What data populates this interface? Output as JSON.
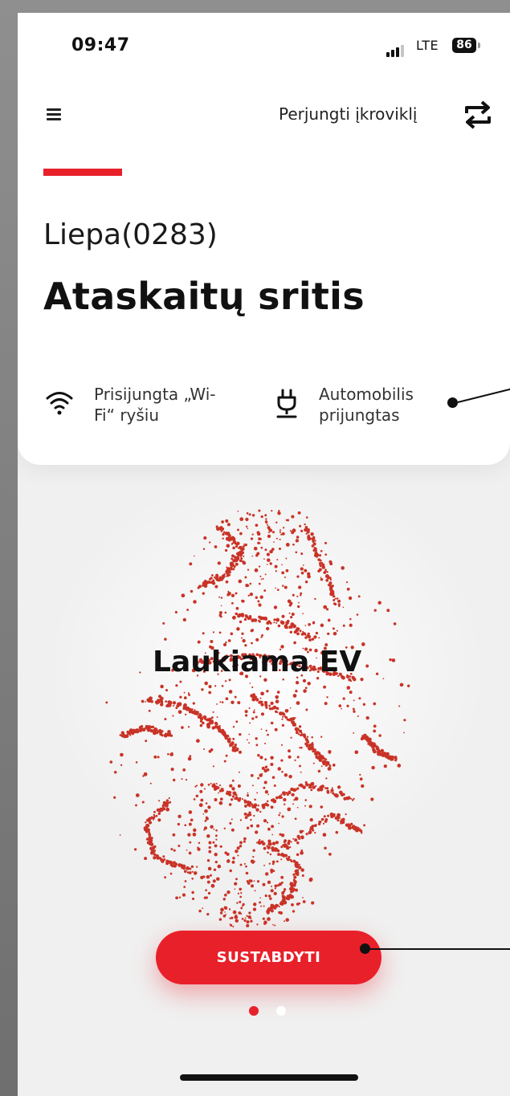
{
  "status_bar": {
    "time": "09:47",
    "network": "LTE",
    "battery": "86"
  },
  "header": {
    "menu_icon": "hamburger-menu-icon",
    "switch_label": "Perjungti įkroviklį",
    "switch_icon": "swap-arrows-icon"
  },
  "charger": {
    "name": "Liepa(0283)",
    "section_title": "Ataskaitų sritis",
    "wifi_status": "Prisijungta „Wi-Fi“ ryšiu",
    "wifi_status_line1": "Prisijungta „Wi-",
    "wifi_status_line2": "Fi“ ryšiu",
    "car_status": "Automobilis prijungtas",
    "car_status_line1": "Automobilis",
    "car_status_line2": "prijungtas"
  },
  "main": {
    "state_text": "Laukiama EV",
    "stop_button": "SUSTABDYTI"
  },
  "pagination": {
    "total": 2,
    "active": 1
  },
  "colors": {
    "accent": "#e8202a",
    "particles": "#c93327",
    "background": "#f0f0f0"
  }
}
